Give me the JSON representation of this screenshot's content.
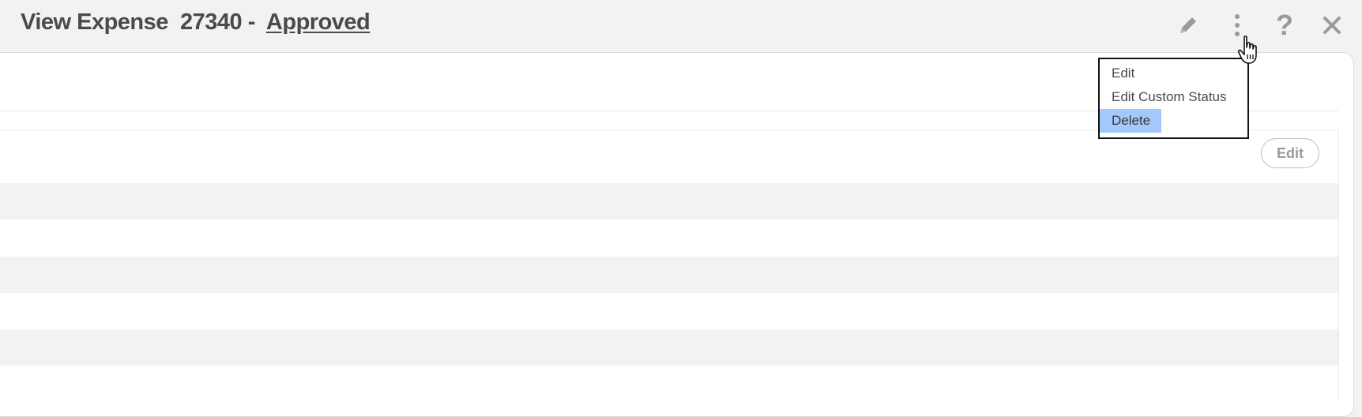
{
  "header": {
    "title_prefix": "View Expense  27340 -  ",
    "status": "Approved",
    "icons": [
      "pencil-icon",
      "more-vertical-icon",
      "help-icon",
      "close-icon"
    ],
    "help_glyph": "?"
  },
  "menu": {
    "items": [
      {
        "label": "Edit",
        "highlighted": false
      },
      {
        "label": "Edit Custom Status",
        "highlighted": false
      },
      {
        "label": "Delete",
        "highlighted": true
      }
    ],
    "highlight_color": "#a3c8fb"
  },
  "section": {
    "edit_label": "Edit"
  },
  "colors": {
    "background": "#f2f2f2",
    "panel": "#ffffff",
    "row_shade": "#f2f2f2",
    "icon": "#9a9a9a",
    "title": "#4a4a4a"
  }
}
